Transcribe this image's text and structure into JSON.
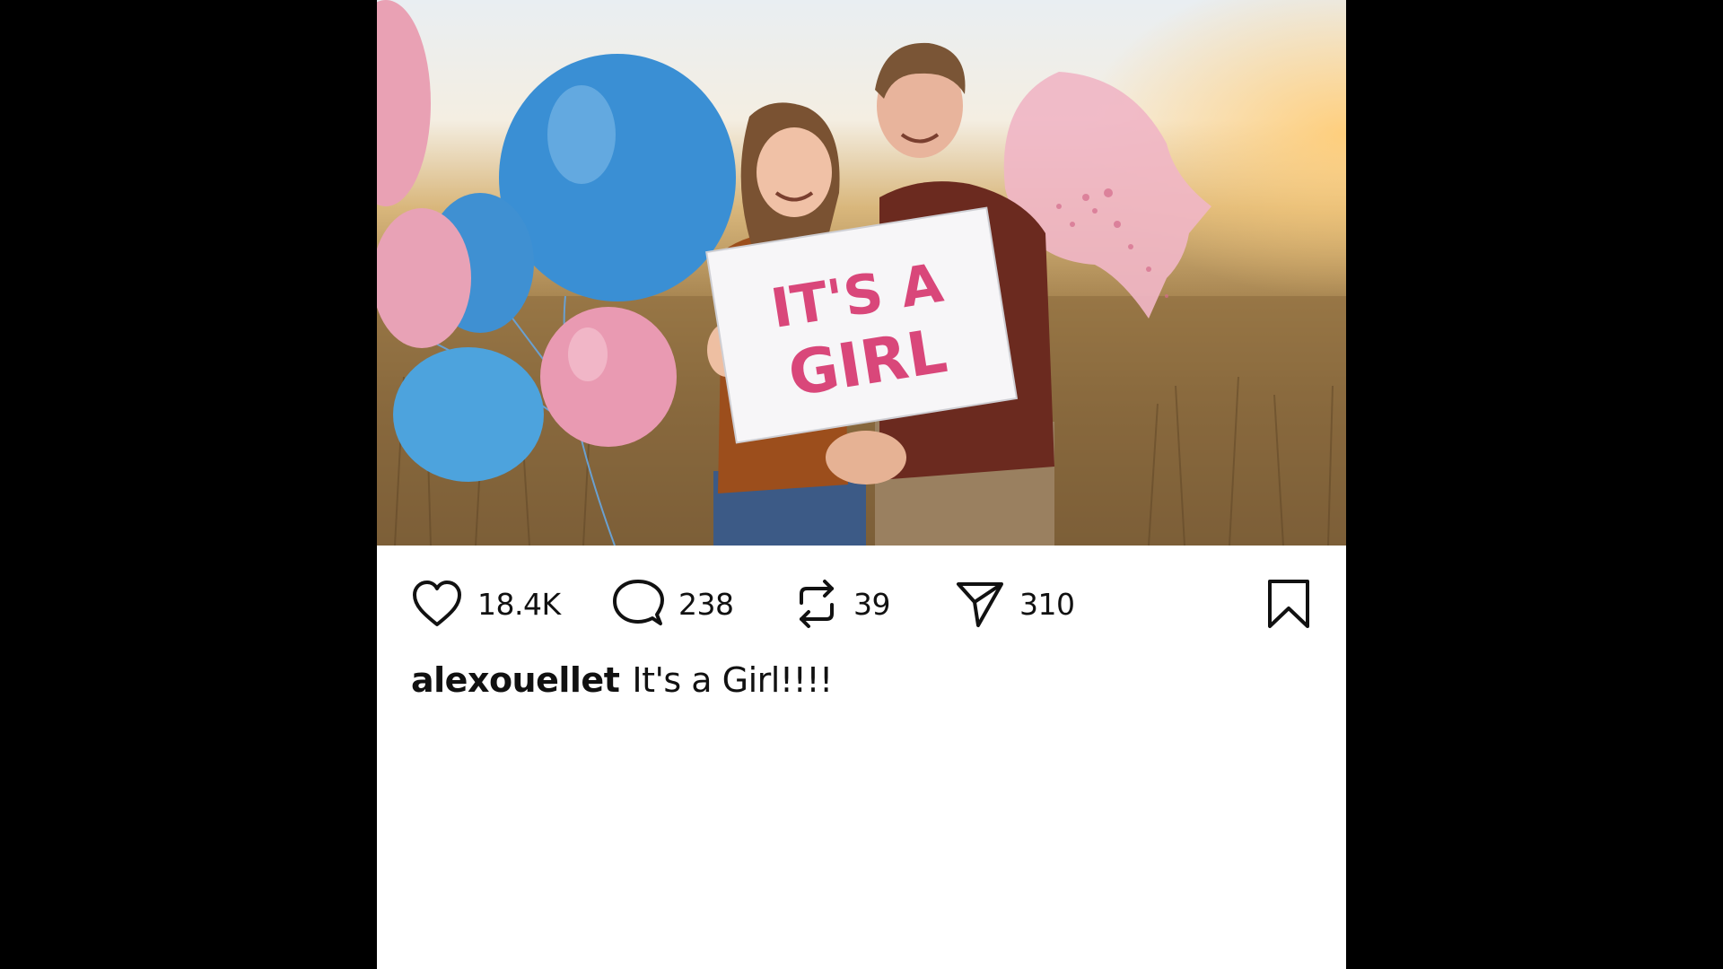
{
  "post": {
    "photo_alt_text": "IT'S A GIRL",
    "sign_line1": "IT'S A",
    "sign_line2": "GIRL",
    "likes": "18.4K",
    "comments": "238",
    "reposts": "39",
    "shares": "310",
    "username": "alexouellet",
    "caption": "It's a Girl!!!!"
  },
  "colors": {
    "background": "#000000",
    "card": "#ffffff",
    "sign_text": "#d9477a",
    "balloon_blue": "#3a8fd4",
    "balloon_pink": "#e8a2b6"
  },
  "icons": [
    "heart-icon",
    "comment-icon",
    "repost-icon",
    "share-icon",
    "bookmark-icon"
  ]
}
